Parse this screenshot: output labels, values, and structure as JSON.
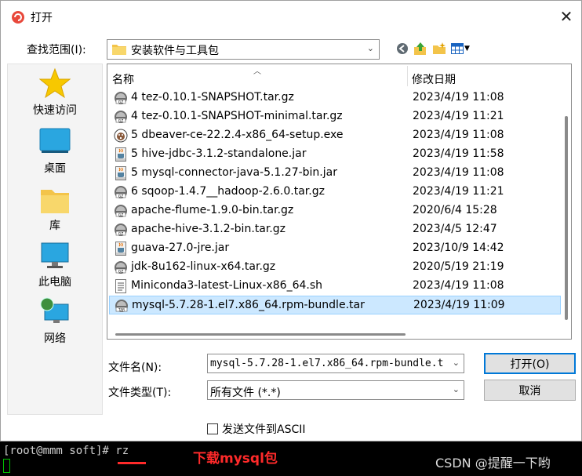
{
  "dialog": {
    "title": "打开",
    "look_in_label": "查找范围(I):",
    "look_in_value": "安装软件与工具包",
    "file_name_label": "文件名(N):",
    "file_name_value": "mysql-5.7.28-1.el7.x86_64.rpm-bundle.t",
    "file_type_label": "文件类型(T):",
    "file_type_value": "所有文件 (*.*)",
    "open_button": "打开(O)",
    "cancel_button": "取消",
    "ascii_checkbox_label": "发送文件到ASCII",
    "ascii_checked": false
  },
  "places": [
    {
      "label": "快速访问",
      "icon": "star-icon"
    },
    {
      "label": "桌面",
      "icon": "desktop-icon"
    },
    {
      "label": "库",
      "icon": "library-folder-icon"
    },
    {
      "label": "此电脑",
      "icon": "computer-icon"
    },
    {
      "label": "网络",
      "icon": "network-icon"
    }
  ],
  "columns": {
    "name": "名称",
    "date": "修改日期"
  },
  "files": [
    {
      "name": "4 tez-0.10.1-SNAPSHOT.tar.gz",
      "date": "2023/4/19 11:08",
      "icon": "gz-archive-icon"
    },
    {
      "name": "4 tez-0.10.1-SNAPSHOT-minimal.tar.gz",
      "date": "2023/4/19 11:21",
      "icon": "gz-archive-icon"
    },
    {
      "name": "5 dbeaver-ce-22.2.4-x86_64-setup.exe",
      "date": "2023/4/19 11:08",
      "icon": "dbeaver-app-icon"
    },
    {
      "name": "5 hive-jdbc-3.1.2-standalone.jar",
      "date": "2023/4/19 11:58",
      "icon": "jar-icon"
    },
    {
      "name": "5 mysql-connector-java-5.1.27-bin.jar",
      "date": "2023/4/19 11:08",
      "icon": "jar-icon"
    },
    {
      "name": "6 sqoop-1.4.7__hadoop-2.6.0.tar.gz",
      "date": "2023/4/19 11:21",
      "icon": "gz-archive-icon"
    },
    {
      "name": "apache-flume-1.9.0-bin.tar.gz",
      "date": "2020/6/4 15:28",
      "icon": "gz-archive-icon"
    },
    {
      "name": "apache-hive-3.1.2-bin.tar.gz",
      "date": "2023/4/5 12:47",
      "icon": "gz-archive-icon"
    },
    {
      "name": "guava-27.0-jre.jar",
      "date": "2023/10/9 14:42",
      "icon": "jar-icon"
    },
    {
      "name": "jdk-8u162-linux-x64.tar.gz",
      "date": "2020/5/19 21:19",
      "icon": "gz-archive-icon"
    },
    {
      "name": "Miniconda3-latest-Linux-x86_64.sh",
      "date": "2023/4/19 11:08",
      "icon": "script-file-icon"
    },
    {
      "name": "mysql-5.7.28-1.el7.x86_64.rpm-bundle.tar",
      "date": "2023/4/19 11:09",
      "icon": "tar-archive-icon",
      "selected": true
    }
  ],
  "terminal": {
    "prompt": "[root@mmm soft]# rz",
    "annotation": "下载mysql包",
    "watermark": "CSDN @提醒一下哟"
  },
  "colors": {
    "selection_bg": "#cce8ff",
    "selection_border": "#99d1ff",
    "default_button_border": "#0078d7",
    "annotation_red": "#ff2a2a",
    "terminal_bg": "#000000"
  }
}
